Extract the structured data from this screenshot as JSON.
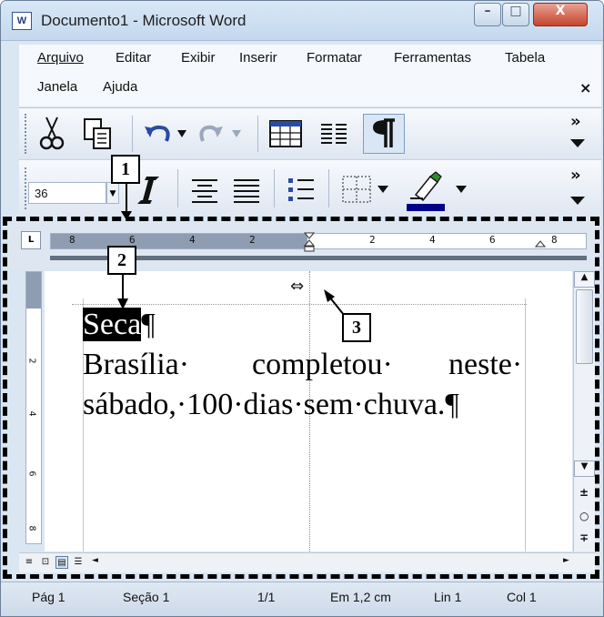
{
  "window": {
    "title": "Documento1 - Microsoft Word",
    "app_icon_letter": "W",
    "minimize": "–",
    "maximize": "□",
    "close": "X"
  },
  "menu": {
    "items": [
      "Arquivo",
      "Editar",
      "Exibir",
      "Inserir",
      "Formatar",
      "Ferramentas",
      "Tabela",
      "Janela",
      "Ajuda"
    ],
    "close_doc": "×"
  },
  "toolbar_standard": {
    "overflow": "»",
    "icons": [
      "cut-icon",
      "paste-icon",
      "undo-icon",
      "redo-icon",
      "insert-table-icon",
      "columns-icon",
      "show-formatting-icon"
    ]
  },
  "toolbar_formatting": {
    "font_size": "36",
    "overflow": "»",
    "icons": [
      "italic-icon",
      "align-center-icon",
      "justify-icon",
      "bullets-icon",
      "borders-icon",
      "highlight-icon"
    ],
    "highlight_color": "#00008b"
  },
  "ruler": {
    "tab_selector": "L",
    "numbers": [
      "8",
      "6",
      "4",
      "2",
      "2",
      "4",
      "6",
      "8"
    ]
  },
  "vruler": {
    "numbers": [
      "2",
      "4",
      "6",
      "8"
    ]
  },
  "document": {
    "line1_selected": "Seca",
    "line1_mark": "¶",
    "line2": [
      "Brasília·",
      "completou·",
      "neste·"
    ],
    "line3": "sábado,·100·dias·sem·chuva.¶"
  },
  "scrollbar": {
    "up": "▲",
    "down": "▼",
    "prev_page": "±",
    "select_browse": "○",
    "next_page": "∓"
  },
  "hscroll": {
    "views": [
      "≡",
      "⊡",
      "▤",
      "☰"
    ],
    "left": "◄",
    "right": "►"
  },
  "status": {
    "page": "Pág 1",
    "section": "Seção 1",
    "pages": "1/1",
    "position": "Em 1,2 cm",
    "line": "Lin 1",
    "column": "Col 1"
  },
  "annotations": [
    "1",
    "2",
    "3"
  ]
}
